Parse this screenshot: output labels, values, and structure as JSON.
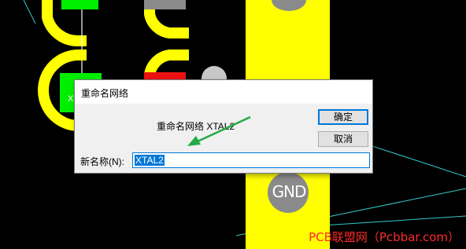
{
  "pcb": {
    "gnd_pad_label": "GND",
    "pad_partial_text": "X",
    "watermark": "PCB联盟网（Pcbbar.com）",
    "colors": {
      "background": "#000000",
      "track_yellow": "#ffff00",
      "pad_green": "#00ee00",
      "pad_red": "#ee1111",
      "pad_gray": "#8a8a8a",
      "net_line_cyan": "#35c9c9"
    }
  },
  "dialog": {
    "title": "重命名网络",
    "prompt": "重命名网络 XTAL2",
    "ok_label": "确定",
    "cancel_label": "取消",
    "name_field_label": "新名称(N):",
    "name_field_value": "XTAL2",
    "annotation_arrow_color": "#22aa44"
  }
}
